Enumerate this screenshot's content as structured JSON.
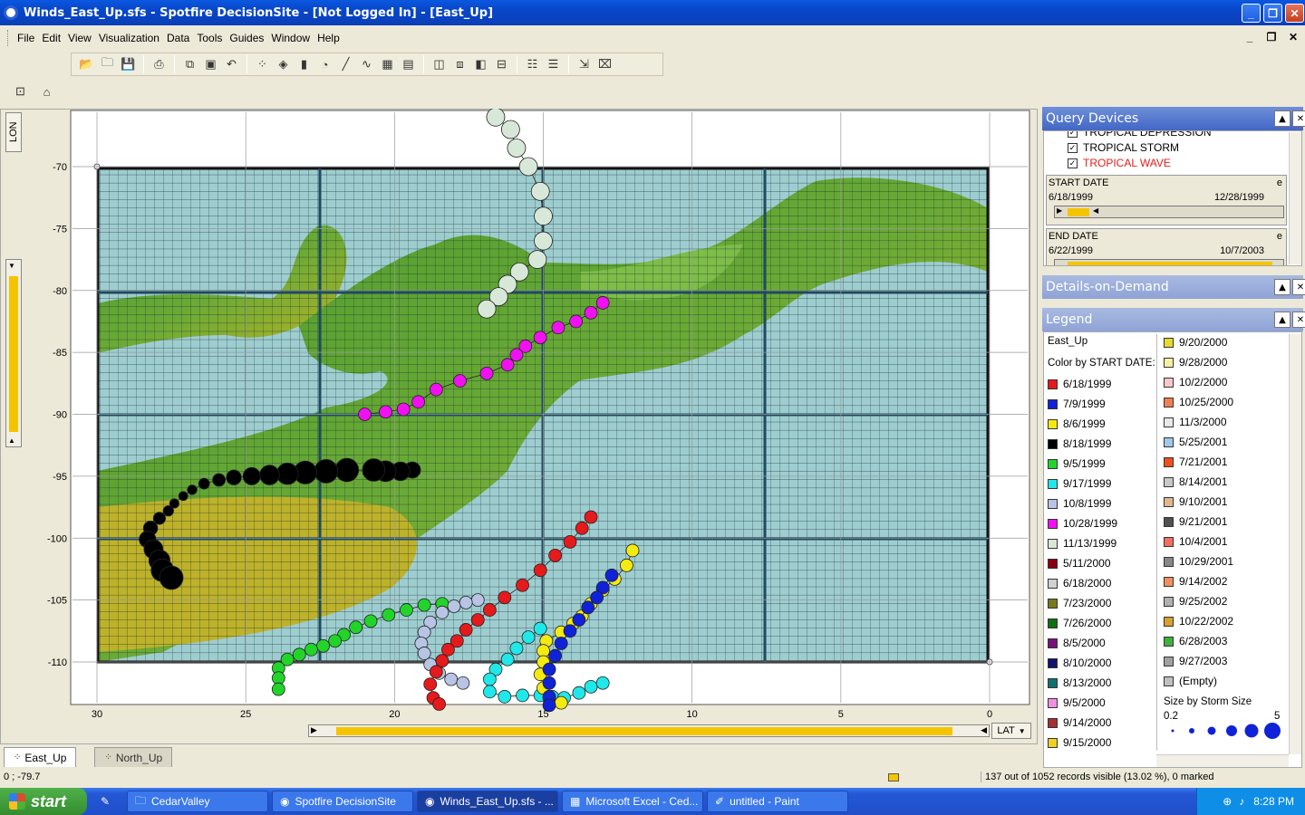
{
  "window": {
    "title": "Winds_East_Up.sfs - Spotfire DecisionSite - [Not Logged In] - [East_Up]"
  },
  "menu": [
    "File",
    "Edit",
    "View",
    "Visualization",
    "Data",
    "Tools",
    "Guides",
    "Window",
    "Help"
  ],
  "axis": {
    "y_label": "LON",
    "x_label": "LAT",
    "x_ticks": [
      "30",
      "25",
      "20",
      "15",
      "10",
      "5",
      "0"
    ],
    "y_ticks": [
      "-70",
      "-75",
      "-80",
      "-85",
      "-90",
      "-95",
      "-100",
      "-105",
      "-110"
    ]
  },
  "tabs": [
    {
      "label": "East_Up",
      "active": true
    },
    {
      "label": "North_Up",
      "active": false
    }
  ],
  "status": {
    "coord": "0 ; -79.7",
    "records": "137 out of 1052 records visible (13.02 %), 0 marked"
  },
  "panels": {
    "query_devices": "Query Devices",
    "details": "Details-on-Demand",
    "legend": "Legend"
  },
  "query": {
    "checks": [
      {
        "label": "TROPICAL DEPRESSION",
        "checked": true
      },
      {
        "label": "TROPICAL STORM",
        "checked": true
      },
      {
        "label": "TROPICAL WAVE",
        "checked": true,
        "color": "#e0201c"
      }
    ],
    "start": {
      "label": "START DATE",
      "min": "6/18/1999",
      "max": "12/28/1999",
      "flag": "e"
    },
    "end": {
      "label": "END DATE",
      "min": "6/22/1999",
      "max": "10/7/2003",
      "flag": "e"
    }
  },
  "legend": {
    "title": "East_Up",
    "color_by": "Color by START DATE:",
    "size_by": "Size by Storm Size",
    "size_min": "0.2",
    "size_max": "5",
    "col1": [
      {
        "label": "6/18/1999",
        "color": "#e41a1c"
      },
      {
        "label": "7/9/1999",
        "color": "#1022d8"
      },
      {
        "label": "8/6/1999",
        "color": "#f5ea10"
      },
      {
        "label": "8/18/1999",
        "color": "#000000"
      },
      {
        "label": "9/5/1999",
        "color": "#22d42a"
      },
      {
        "label": "9/17/1999",
        "color": "#20e8e8"
      },
      {
        "label": "10/8/1999",
        "color": "#b8c4e4"
      },
      {
        "label": "10/28/1999",
        "color": "#f010f0"
      },
      {
        "label": "11/13/1999",
        "color": "#d8e8d8"
      },
      {
        "label": "5/11/2000",
        "color": "#880010"
      },
      {
        "label": "6/18/2000",
        "color": "#d0d0d0"
      },
      {
        "label": "7/23/2000",
        "color": "#787820"
      },
      {
        "label": "7/26/2000",
        "color": "#107010"
      },
      {
        "label": "8/5/2000",
        "color": "#781078"
      },
      {
        "label": "8/10/2000",
        "color": "#101070"
      },
      {
        "label": "8/13/2000",
        "color": "#107070"
      },
      {
        "label": "9/5/2000",
        "color": "#f090e0"
      },
      {
        "label": "9/14/2000",
        "color": "#a83030"
      },
      {
        "label": "9/15/2000",
        "color": "#f0d020"
      }
    ],
    "col2": [
      {
        "label": "9/20/2000",
        "color": "#e8d830"
      },
      {
        "label": "9/28/2000",
        "color": "#f8f0a0"
      },
      {
        "label": "10/2/2000",
        "color": "#f8c8c8"
      },
      {
        "label": "10/25/2000",
        "color": "#f08050"
      },
      {
        "label": "11/3/2000",
        "color": "#e8e8e8"
      },
      {
        "label": "5/25/2001",
        "color": "#a0c8e8"
      },
      {
        "label": "7/21/2001",
        "color": "#f05020"
      },
      {
        "label": "8/14/2001",
        "color": "#c8c8c8"
      },
      {
        "label": "9/10/2001",
        "color": "#e0b890"
      },
      {
        "label": "9/21/2001",
        "color": "#505050"
      },
      {
        "label": "10/4/2001",
        "color": "#f07060"
      },
      {
        "label": "10/29/2001",
        "color": "#888888"
      },
      {
        "label": "9/14/2002",
        "color": "#f09060"
      },
      {
        "label": "9/25/2002",
        "color": "#b0b0b0"
      },
      {
        "label": "10/22/2002",
        "color": "#d8a030"
      },
      {
        "label": "6/28/2003",
        "color": "#40b040"
      },
      {
        "label": "9/27/2003",
        "color": "#a0a0a0"
      },
      {
        "label": "(Empty)",
        "color": "#c0c0c0"
      }
    ]
  },
  "taskbar": {
    "start": "start",
    "items": [
      {
        "label": "CedarValley"
      },
      {
        "label": "Spotfire DecisionSite"
      },
      {
        "label": "Winds_East_Up.sfs - ...",
        "active": true
      },
      {
        "label": "Microsoft Excel - Ced..."
      },
      {
        "label": "untitled - Paint"
      }
    ],
    "time": "8:28 PM"
  },
  "chart_data": {
    "type": "scatter",
    "xlabel": "LAT",
    "ylabel": "LON",
    "xlim": [
      30,
      0
    ],
    "ylim": [
      -70,
      -110
    ],
    "series": [
      {
        "color": "#d8e8d8",
        "points": [
          [
            16.6,
            -66
          ],
          [
            16.1,
            -67
          ],
          [
            15.9,
            -68.5
          ],
          [
            15.5,
            -70
          ],
          [
            15.1,
            -72
          ],
          [
            15.0,
            -74
          ],
          [
            15.0,
            -76
          ],
          [
            15.2,
            -77.5
          ],
          [
            15.8,
            -78.5
          ],
          [
            16.2,
            -79.5
          ],
          [
            16.5,
            -80.5
          ],
          [
            16.9,
            -81.5
          ]
        ]
      },
      {
        "color": "#f010f0",
        "points": [
          [
            13.0,
            -81
          ],
          [
            13.4,
            -81.8
          ],
          [
            13.9,
            -82.5
          ],
          [
            14.5,
            -83
          ],
          [
            15.1,
            -83.8
          ],
          [
            15.6,
            -84.5
          ],
          [
            15.9,
            -85.2
          ],
          [
            16.2,
            -86
          ],
          [
            16.9,
            -86.7
          ],
          [
            17.8,
            -87.3
          ],
          [
            18.6,
            -88
          ],
          [
            19.2,
            -89
          ],
          [
            19.7,
            -89.6
          ],
          [
            20.3,
            -89.8
          ],
          [
            21.0,
            -90
          ]
        ]
      },
      {
        "color": "#000000",
        "points": [
          [
            19.4,
            -94.5
          ],
          [
            19.8,
            -94.6
          ],
          [
            20.3,
            -94.6
          ],
          [
            20.7,
            -94.5
          ],
          [
            21.6,
            -94.5
          ],
          [
            22.3,
            -94.6
          ],
          [
            23.0,
            -94.7
          ],
          [
            23.6,
            -94.8
          ],
          [
            24.2,
            -94.9
          ],
          [
            24.8,
            -95.0
          ],
          [
            25.4,
            -95.1
          ],
          [
            25.9,
            -95.3
          ],
          [
            26.4,
            -95.6
          ],
          [
            26.8,
            -96.1
          ],
          [
            27.1,
            -96.6
          ],
          [
            27.4,
            -97.2
          ],
          [
            27.6,
            -97.8
          ],
          [
            27.9,
            -98.4
          ],
          [
            28.2,
            -99.2
          ],
          [
            28.3,
            -100.1
          ],
          [
            28.1,
            -100.9
          ],
          [
            27.9,
            -101.8
          ],
          [
            27.8,
            -102.6
          ],
          [
            27.5,
            -103.2
          ]
        ]
      },
      {
        "color": "#22d42a",
        "points": [
          [
            18.4,
            -105.3
          ],
          [
            19.0,
            -105.4
          ],
          [
            19.6,
            -105.8
          ],
          [
            20.2,
            -106.2
          ],
          [
            20.8,
            -106.7
          ],
          [
            21.3,
            -107.2
          ],
          [
            21.7,
            -107.8
          ],
          [
            22.0,
            -108.3
          ],
          [
            22.4,
            -108.7
          ],
          [
            22.8,
            -109.0
          ],
          [
            23.2,
            -109.4
          ],
          [
            23.6,
            -109.8
          ],
          [
            23.9,
            -110.5
          ],
          [
            23.9,
            -111.3
          ],
          [
            23.9,
            -112.2
          ]
        ]
      },
      {
        "color": "#b8c4e4",
        "points": [
          [
            17.2,
            -105
          ],
          [
            17.6,
            -105.2
          ],
          [
            18.0,
            -105.5
          ],
          [
            18.4,
            -106.0
          ],
          [
            18.8,
            -106.8
          ],
          [
            19.0,
            -107.6
          ],
          [
            19.1,
            -108.5
          ],
          [
            19.0,
            -109.3
          ],
          [
            18.8,
            -110.2
          ],
          [
            18.5,
            -110.9
          ],
          [
            18.1,
            -111.4
          ],
          [
            17.7,
            -111.7
          ]
        ]
      },
      {
        "color": "#e41a1c",
        "points": [
          [
            13.4,
            -98.3
          ],
          [
            13.7,
            -99.2
          ],
          [
            14.1,
            -100.3
          ],
          [
            14.6,
            -101.4
          ],
          [
            15.1,
            -102.6
          ],
          [
            15.7,
            -103.8
          ],
          [
            16.3,
            -104.8
          ],
          [
            16.8,
            -105.8
          ],
          [
            17.2,
            -106.6
          ],
          [
            17.6,
            -107.4
          ],
          [
            17.9,
            -108.3
          ],
          [
            18.2,
            -109.0
          ],
          [
            18.4,
            -109.9
          ],
          [
            18.6,
            -110.8
          ],
          [
            18.8,
            -111.8
          ],
          [
            18.7,
            -112.9
          ],
          [
            18.5,
            -113.4
          ]
        ]
      },
      {
        "color": "#20e8e8",
        "points": [
          [
            15.1,
            -107.3
          ],
          [
            15.5,
            -108.0
          ],
          [
            15.9,
            -108.9
          ],
          [
            16.2,
            -109.8
          ],
          [
            16.6,
            -110.6
          ],
          [
            16.8,
            -111.4
          ],
          [
            16.8,
            -112.4
          ],
          [
            16.3,
            -112.8
          ],
          [
            15.7,
            -112.7
          ],
          [
            15.1,
            -112.7
          ],
          [
            14.7,
            -112.8
          ],
          [
            14.3,
            -112.9
          ],
          [
            13.8,
            -112.5
          ],
          [
            13.4,
            -112.0
          ],
          [
            13.0,
            -111.7
          ]
        ]
      },
      {
        "color": "#f5ea10",
        "points": [
          [
            12.0,
            -101.0
          ],
          [
            12.2,
            -102.2
          ],
          [
            12.6,
            -103.3
          ],
          [
            13.0,
            -104.2
          ],
          [
            13.4,
            -105.3
          ],
          [
            13.7,
            -106.3
          ],
          [
            14.0,
            -106.9
          ],
          [
            14.4,
            -107.6
          ],
          [
            14.9,
            -108.3
          ],
          [
            15.0,
            -109.1
          ],
          [
            15.0,
            -110.0
          ],
          [
            15.1,
            -111.0
          ],
          [
            15.0,
            -112.1
          ],
          [
            14.8,
            -112.9
          ],
          [
            14.4,
            -113.3
          ]
        ]
      },
      {
        "color": "#1022d8",
        "points": [
          [
            12.7,
            -103
          ],
          [
            13.0,
            -104
          ],
          [
            13.2,
            -104.8
          ],
          [
            13.5,
            -105.6
          ],
          [
            13.8,
            -106.6
          ],
          [
            14.1,
            -107.5
          ],
          [
            14.4,
            -108.5
          ],
          [
            14.6,
            -109.5
          ],
          [
            14.8,
            -110.6
          ],
          [
            14.8,
            -111.7
          ],
          [
            14.8,
            -112.8
          ],
          [
            14.8,
            -113.5
          ]
        ]
      }
    ]
  }
}
